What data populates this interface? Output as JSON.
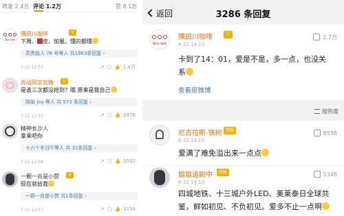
{
  "left": {
    "tabs": [
      {
        "label": "转发 2.4万"
      },
      {
        "label": "评论 1.2万"
      },
      {
        "label": "赞 8.1万"
      }
    ],
    "comments": [
      {
        "name": "隅田川咖啡",
        "text": "下周、",
        "text_tag": "皮、加量。懂的都懂",
        "sub_names": "高贵路人 78 号等人",
        "sub_count": "共1963条回复",
        "time": "7-11 12:57",
        "likes": "1.4万"
      },
      {
        "name": "肖战网官官微",
        "text": "是谁三次都没抢到？哦 原来是我自己",
        "sub_names": "陪染 Joy 等人",
        "sub_count": "共 573 条回复",
        "time": "7-11 12:57",
        "likes": "2476"
      },
      {
        "name": "精神长沙人",
        "text": "拿来吧你",
        "sub_names": "十六个冬日吖等人",
        "sub_count": "共 31条回复",
        "time": "7-11 12:58",
        "likes": "3502"
      },
      {
        "name": "一颗一肖是小赞",
        "text": "现在就给我",
        "sub_names": "一颗一肖是小赞",
        "sub_count": "共1条回复",
        "time": "7-11 12:57",
        "likes": "3154"
      }
    ]
  },
  "right": {
    "back_label": "返回",
    "title": "3286 条回复",
    "post": {
      "name": "隅田川咖啡",
      "time": "6-22 14:15",
      "likes": "2.7万",
      "text_line1": "卡到了14：01，爱是不是，多一点，也没关",
      "text_line2": "系",
      "view_original": "查看原微博"
    },
    "sort_label": "按热度",
    "replies": [
      {
        "name": "尼古拉斯-铁树",
        "badge": "铁粉",
        "time": "6-22 14:15",
        "likes": "8558",
        "text": "爱满了难免溢出来一点点"
      },
      {
        "name": "姐姐追剧中",
        "badge": "铁粉",
        "time": "6-22 14:15",
        "likes": "5348",
        "text_line1": "四城地铁、十三城户外LED、美莱泰日全球共",
        "text_line2": "鉴，鲜如初见、不负初见。爱多不止一点啊"
      }
    ]
  },
  "logo_text": "隅田川咖啡",
  "colors": {
    "accent_orange": "#e86b00",
    "tab_underline": "#f08a00",
    "link_blue": "#3f78b8",
    "badge_gold": "#f4b000",
    "right_bg": "#f2f2f2"
  },
  "icons": [
    "chevron-left-icon",
    "thumb-up-icon",
    "comment-icon",
    "share-icon",
    "sort-icon",
    "emoji-icon",
    "verified-badge-icon"
  ]
}
